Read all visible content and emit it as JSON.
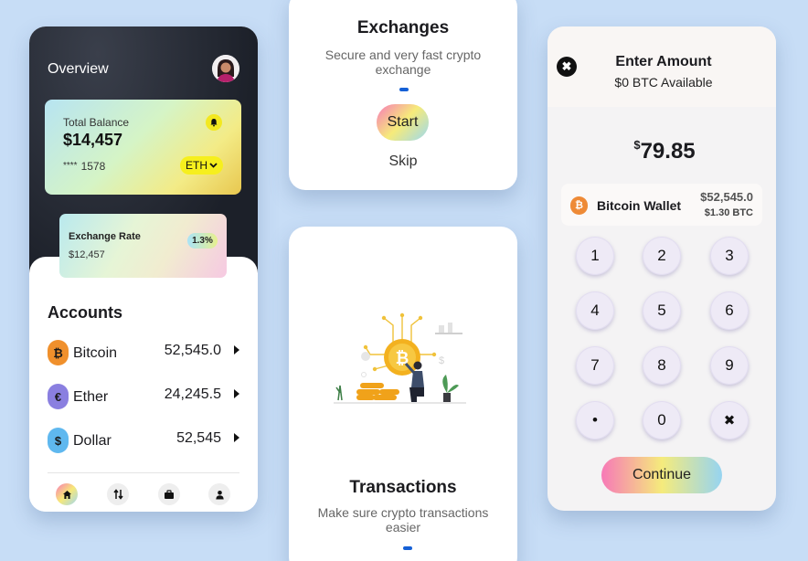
{
  "overview": {
    "title": "Overview",
    "total_balance_label": "Total Balance",
    "total_balance": "$14,457",
    "card_masked": "****",
    "card_last4": "1578",
    "currency_select": "ETH",
    "exchange_rate_label": "Exchange Rate",
    "exchange_rate_value": "$12,457",
    "exchange_rate_badge": "1.3%",
    "accounts_title": "Accounts",
    "accounts": [
      {
        "name": "Bitcoin",
        "value": "52,545.0",
        "symbol": "₿",
        "color": "#f0902c"
      },
      {
        "name": "Ether",
        "value": "24,245.5",
        "symbol": "€",
        "color": "#8a7fe0"
      },
      {
        "name": "Dollar",
        "value": "52,545",
        "symbol": "$",
        "color": "#5fb8ef"
      }
    ],
    "nav": [
      "home-icon",
      "swap-icon",
      "briefcase-icon",
      "user-icon"
    ]
  },
  "exchanges": {
    "title": "Exchanges",
    "subtitle": "Secure and very fast crypto exchange",
    "start_label": "Start",
    "skip_label": "Skip"
  },
  "transactions": {
    "title": "Transactions",
    "subtitle": "Make sure crypto transactions easier"
  },
  "amount": {
    "title": "Enter Amount",
    "available": "$0 BTC Available",
    "currency_symbol": "$",
    "value": "79.85",
    "wallet_name": "Bitcoin Wallet",
    "wallet_balance": "$52,545.0",
    "wallet_btc": "$1.30 BTC",
    "keys": [
      "1",
      "2",
      "3",
      "4",
      "5",
      "6",
      "7",
      "8",
      "9",
      "•",
      "0",
      "✖"
    ],
    "continue_label": "Continue"
  },
  "colors": {
    "background": "#c7ddf6",
    "accent_blue": "#1560d6",
    "dark_header": "#1c2029",
    "bitcoin_orange": "#f0902c"
  }
}
